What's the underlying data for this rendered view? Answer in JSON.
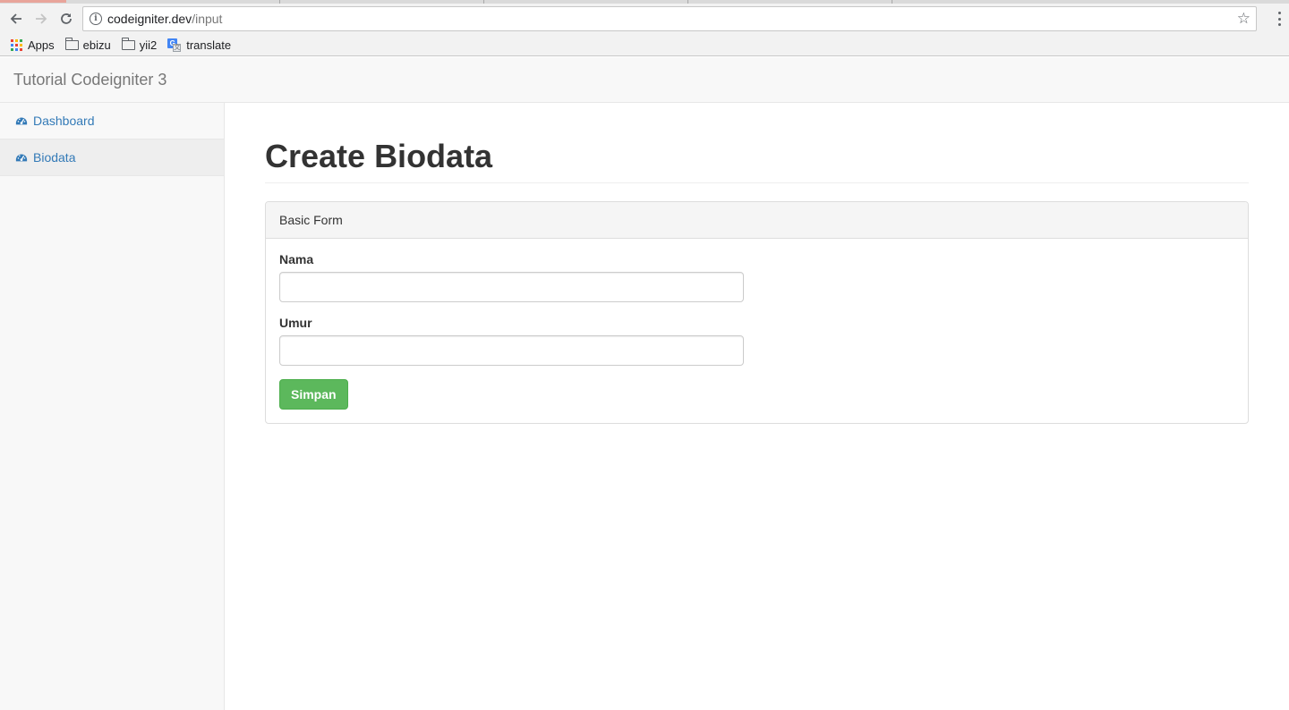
{
  "browser": {
    "url_host": "codeigniter.dev",
    "url_path": "/input",
    "bookmarks": [
      {
        "label": "Apps",
        "icon": "apps-grid-icon"
      },
      {
        "label": "ebizu",
        "icon": "folder-icon"
      },
      {
        "label": "yii2",
        "icon": "folder-icon"
      },
      {
        "label": "translate",
        "icon": "google-translate-icon"
      }
    ]
  },
  "navbar": {
    "brand": "Tutorial Codeigniter 3"
  },
  "sidebar": {
    "items": [
      {
        "label": "Dashboard",
        "icon": "dashboard-icon",
        "active": false
      },
      {
        "label": "Biodata",
        "icon": "dashboard-icon",
        "active": true
      }
    ]
  },
  "main": {
    "title": "Create Biodata",
    "panel": {
      "heading": "Basic Form",
      "fields": [
        {
          "label": "Nama",
          "value": ""
        },
        {
          "label": "Umur",
          "value": ""
        }
      ],
      "submit_label": "Simpan"
    }
  },
  "colors": {
    "link": "#337ab7",
    "success": "#5cb85c",
    "navbar_bg": "#f8f8f8"
  }
}
